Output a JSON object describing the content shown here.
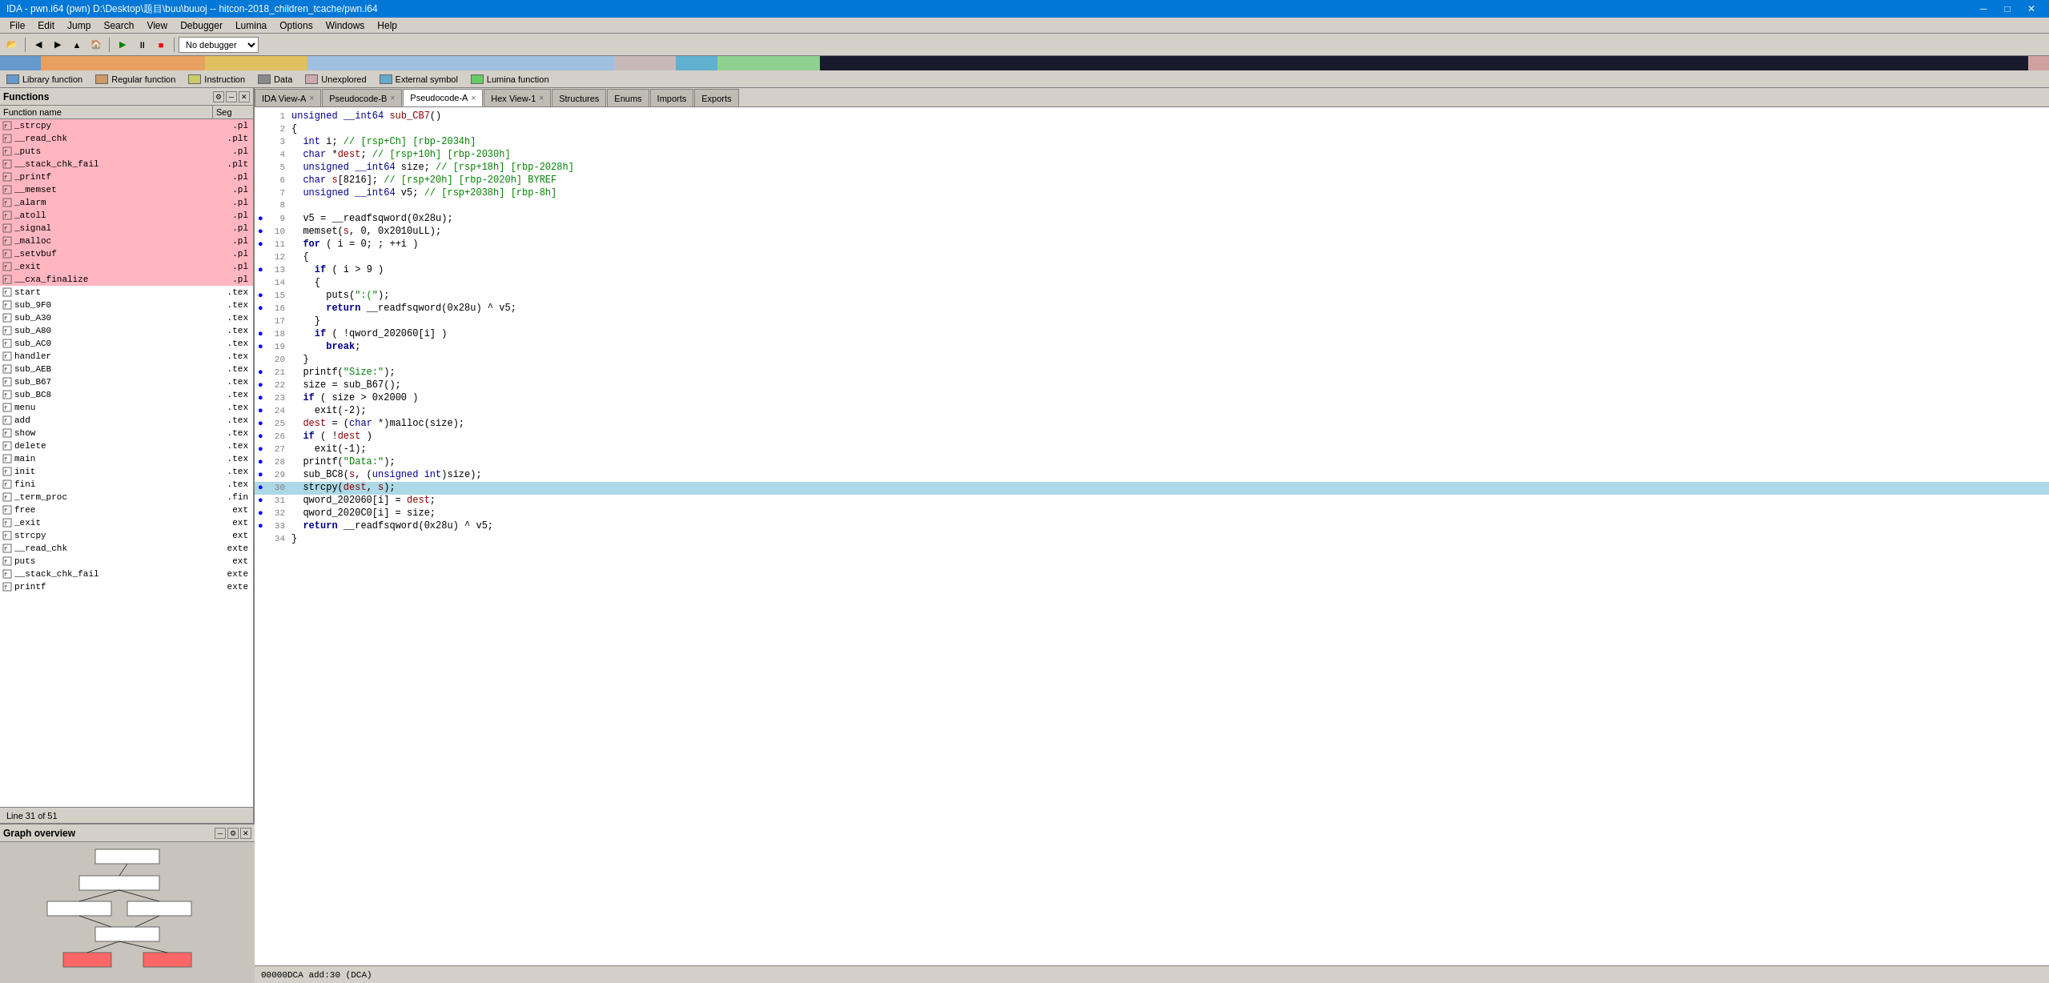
{
  "title_bar": {
    "text": "IDA - pwn.i64 (pwn) D:\\Desktop\\题目\\buu\\buuoj -- hitcon-2018_children_tcache/pwn.i64",
    "min_label": "─",
    "max_label": "□",
    "close_label": "✕"
  },
  "menu": {
    "items": [
      "File",
      "Edit",
      "Jump",
      "Search",
      "View",
      "Debugger",
      "Lumina",
      "Options",
      "Windows",
      "Help"
    ]
  },
  "legend": {
    "items": [
      {
        "color": "#6699cc",
        "label": "Library function"
      },
      {
        "color": "#cc9966",
        "label": "Regular function"
      },
      {
        "color": "#cccc66",
        "label": "Instruction"
      },
      {
        "color": "#888888",
        "label": "Data"
      },
      {
        "color": "#ccaaaa",
        "label": "Unexplored"
      },
      {
        "color": "#66aacc",
        "label": "External symbol"
      },
      {
        "color": "#66cc66",
        "label": "Lumina function"
      }
    ]
  },
  "functions_panel": {
    "title": "Functions",
    "col_name": "Function name",
    "col_seg": "Seg",
    "line_info": "Line 31 of 51",
    "items": [
      {
        "name": "_strcpy",
        "seg": ".pl",
        "pink": true
      },
      {
        "name": "__read_chk",
        "seg": ".plt",
        "pink": true
      },
      {
        "name": "_puts",
        "seg": ".pl",
        "pink": true
      },
      {
        "name": "__stack_chk_fail",
        "seg": ".plt",
        "pink": true
      },
      {
        "name": "_printf",
        "seg": ".pl",
        "pink": true
      },
      {
        "name": "__memset",
        "seg": ".pl",
        "pink": true
      },
      {
        "name": "_alarm",
        "seg": ".pl",
        "pink": true
      },
      {
        "name": "_atoll",
        "seg": ".pl",
        "pink": true
      },
      {
        "name": "_signal",
        "seg": ".pl",
        "pink": true
      },
      {
        "name": "_malloc",
        "seg": ".pl",
        "pink": true
      },
      {
        "name": "_setvbuf",
        "seg": ".pl",
        "pink": true
      },
      {
        "name": "_exit",
        "seg": ".pl",
        "pink": true
      },
      {
        "name": "__cxa_finalize",
        "seg": ".pl",
        "pink": true
      },
      {
        "name": "start",
        "seg": ".tex",
        "pink": false
      },
      {
        "name": "sub_9F0",
        "seg": ".tex",
        "pink": false
      },
      {
        "name": "sub_A30",
        "seg": ".tex",
        "pink": false
      },
      {
        "name": "sub_A80",
        "seg": ".tex",
        "pink": false
      },
      {
        "name": "sub_AC0",
        "seg": ".tex",
        "pink": false
      },
      {
        "name": "handler",
        "seg": ".tex",
        "pink": false
      },
      {
        "name": "sub_AEB",
        "seg": ".tex",
        "pink": false
      },
      {
        "name": "sub_B67",
        "seg": ".tex",
        "pink": false
      },
      {
        "name": "sub_BC8",
        "seg": ".tex",
        "pink": false
      },
      {
        "name": "menu",
        "seg": ".tex",
        "pink": false
      },
      {
        "name": "add",
        "seg": ".tex",
        "pink": false
      },
      {
        "name": "show",
        "seg": ".tex",
        "pink": false
      },
      {
        "name": "delete",
        "seg": ".tex",
        "pink": false
      },
      {
        "name": "main",
        "seg": ".tex",
        "pink": false
      },
      {
        "name": "init",
        "seg": ".tex",
        "pink": false
      },
      {
        "name": "fini",
        "seg": ".tex",
        "pink": false
      },
      {
        "name": "_term_proc",
        "seg": ".fin",
        "pink": false
      },
      {
        "name": "free",
        "seg": "ext",
        "pink": false
      },
      {
        "name": "_exit",
        "seg": "ext",
        "pink": false
      },
      {
        "name": "strcpy",
        "seg": "ext",
        "pink": false
      },
      {
        "name": "__read_chk",
        "seg": "exte",
        "pink": false
      },
      {
        "name": "puts",
        "seg": "ext",
        "pink": false
      },
      {
        "name": "__stack_chk_fail",
        "seg": "exte",
        "pink": false
      },
      {
        "name": "printf",
        "seg": "exte",
        "pink": false
      }
    ]
  },
  "graph_overview": {
    "title": "Graph overview"
  },
  "tabs": [
    {
      "label": "IDA View-A",
      "active": false,
      "closeable": true
    },
    {
      "label": "Pseudocode-B",
      "active": false,
      "closeable": true
    },
    {
      "label": "Pseudocode-A",
      "active": true,
      "closeable": true
    },
    {
      "label": "Hex View-1",
      "active": false,
      "closeable": true
    },
    {
      "label": "Structures",
      "active": false,
      "closeable": false
    },
    {
      "label": "Enums",
      "active": false,
      "closeable": false
    },
    {
      "label": "Imports",
      "active": false,
      "closeable": false
    },
    {
      "label": "Exports",
      "active": false,
      "closeable": false
    }
  ],
  "code": {
    "function_name": "sub_CB7",
    "lines": [
      {
        "num": 1,
        "bullet": false,
        "content": "unsigned __int64 sub_CB7()",
        "highlight": false
      },
      {
        "num": 2,
        "bullet": false,
        "content": "{",
        "highlight": false
      },
      {
        "num": 3,
        "bullet": false,
        "content": "  int i; // [rsp+Ch] [rbp-2034h]",
        "highlight": false,
        "comment": true
      },
      {
        "num": 4,
        "bullet": false,
        "content": "  char *dest; // [rsp+10h] [rbp-2030h]",
        "highlight": false,
        "comment": true
      },
      {
        "num": 5,
        "bullet": false,
        "content": "  unsigned __int64 size; // [rsp+18h] [rbp-2028h]",
        "highlight": false,
        "comment": true
      },
      {
        "num": 6,
        "bullet": false,
        "content": "  char s[8216]; // [rsp+20h] [rbp-2020h] BYREF",
        "highlight": false,
        "comment": true
      },
      {
        "num": 7,
        "bullet": false,
        "content": "  unsigned __int64 v5; // [rsp+2038h] [rbp-8h]",
        "highlight": false,
        "comment": true
      },
      {
        "num": 8,
        "bullet": false,
        "content": "",
        "highlight": false
      },
      {
        "num": 9,
        "bullet": true,
        "content": "  v5 = __readfsqword(0x28u);",
        "highlight": false
      },
      {
        "num": 10,
        "bullet": true,
        "content": "  memset(s, 0, 0x2010uLL);",
        "highlight": false
      },
      {
        "num": 11,
        "bullet": true,
        "content": "  for ( i = 0; ; ++i )",
        "highlight": false
      },
      {
        "num": 12,
        "bullet": false,
        "content": "  {",
        "highlight": false
      },
      {
        "num": 13,
        "bullet": true,
        "content": "    if ( i > 9 )",
        "highlight": false
      },
      {
        "num": 14,
        "bullet": false,
        "content": "    {",
        "highlight": false
      },
      {
        "num": 15,
        "bullet": true,
        "content": "      puts(\":(\"  );",
        "highlight": false
      },
      {
        "num": 16,
        "bullet": true,
        "content": "      return __readfsqword(0x28u) ^ v5;",
        "highlight": false
      },
      {
        "num": 17,
        "bullet": false,
        "content": "    }",
        "highlight": false
      },
      {
        "num": 18,
        "bullet": true,
        "content": "    if ( !qword_202060[i] )",
        "highlight": false
      },
      {
        "num": 19,
        "bullet": true,
        "content": "      break;",
        "highlight": false
      },
      {
        "num": 20,
        "bullet": false,
        "content": "  }",
        "highlight": false
      },
      {
        "num": 21,
        "bullet": true,
        "content": "  printf(\"Size:\");",
        "highlight": false
      },
      {
        "num": 22,
        "bullet": true,
        "content": "  size = sub_B67();",
        "highlight": false
      },
      {
        "num": 23,
        "bullet": true,
        "content": "  if ( size > 0x2000 )",
        "highlight": false
      },
      {
        "num": 24,
        "bullet": true,
        "content": "    exit(-2);",
        "highlight": false
      },
      {
        "num": 25,
        "bullet": true,
        "content": "  dest = (char *)malloc(size);",
        "highlight": false
      },
      {
        "num": 26,
        "bullet": true,
        "content": "  if ( !dest )",
        "highlight": false
      },
      {
        "num": 27,
        "bullet": true,
        "content": "    exit(-1);",
        "highlight": false
      },
      {
        "num": 28,
        "bullet": true,
        "content": "  printf(\"Data:\");",
        "highlight": false
      },
      {
        "num": 29,
        "bullet": true,
        "content": "  sub_BC8(s, (unsigned int)size);",
        "highlight": false
      },
      {
        "num": 30,
        "bullet": true,
        "content": "  strcpy(dest, s);",
        "highlight": true
      },
      {
        "num": 31,
        "bullet": true,
        "content": "  qword_202060[i] = dest;",
        "highlight": false
      },
      {
        "num": 32,
        "bullet": true,
        "content": "  qword_2020C0[i] = size;",
        "highlight": false
      },
      {
        "num": 33,
        "bullet": true,
        "content": "  return __readfsqword(0x28u) ^ v5;",
        "highlight": false
      },
      {
        "num": 34,
        "bullet": false,
        "content": "}",
        "highlight": false
      }
    ]
  },
  "bottom_status": {
    "text": "00000DCA add:30  (DCA)"
  },
  "debugger_label": "No debugger"
}
